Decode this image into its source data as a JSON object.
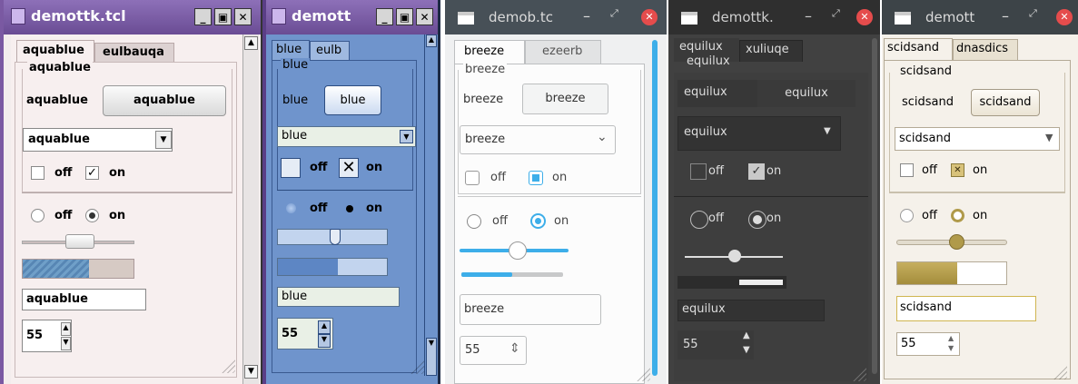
{
  "windows": [
    {
      "title": "demottk.tcl",
      "tabs": [
        "aquablue",
        "eulbauqa"
      ],
      "group": "aquablue",
      "label": "aquablue",
      "button": "aquablue",
      "combo": "aquablue",
      "check_off": "off",
      "check_on": "on",
      "radio_off": "off",
      "radio_on": "on",
      "entry": "aquablue",
      "spin": "55"
    },
    {
      "title": "demott",
      "tabs": [
        "blue",
        "eulb"
      ],
      "group": "blue",
      "label": "blue",
      "button": "blue",
      "combo": "blue",
      "check_off": "off",
      "check_on": "on",
      "radio_off": "off",
      "radio_on": "on",
      "entry": "blue",
      "spin": "55"
    },
    {
      "title": "demob.tc",
      "tabs": [
        "breeze",
        "ezeerb"
      ],
      "group": "breeze",
      "label": "breeze",
      "button": "breeze",
      "combo": "breeze",
      "check_off": "off",
      "check_on": "on",
      "radio_off": "off",
      "radio_on": "on",
      "entry": "breeze",
      "spin": "55"
    },
    {
      "title": "demottk.",
      "tabs": [
        "equilux",
        "xuliuqe"
      ],
      "group": "equilux",
      "label": "equilux",
      "button": "equilux",
      "combo": "equilux",
      "check_off": "off",
      "check_on": "on",
      "radio_off": "off",
      "radio_on": "on",
      "entry": "equilux",
      "spin": "55"
    },
    {
      "title": "demott",
      "tabs": [
        "scidsand",
        "dnasdics"
      ],
      "group": "scidsand",
      "label": "scidsand",
      "button": "scidsand",
      "combo": "scidsand",
      "check_off": "off",
      "check_on": "on",
      "radio_off": "off",
      "radio_on": "on",
      "entry": "scidsand",
      "spin": "55"
    }
  ],
  "progress": [
    0.6,
    0.55,
    0.5,
    0.4,
    0.55
  ],
  "colors": {
    "aqua_titlebar": "#7a59a2",
    "blue_bg": "#6f94cc",
    "breeze_accent": "#3daee9",
    "equilux_bg": "#414141",
    "scidsand_accent": "#b09a4a"
  }
}
